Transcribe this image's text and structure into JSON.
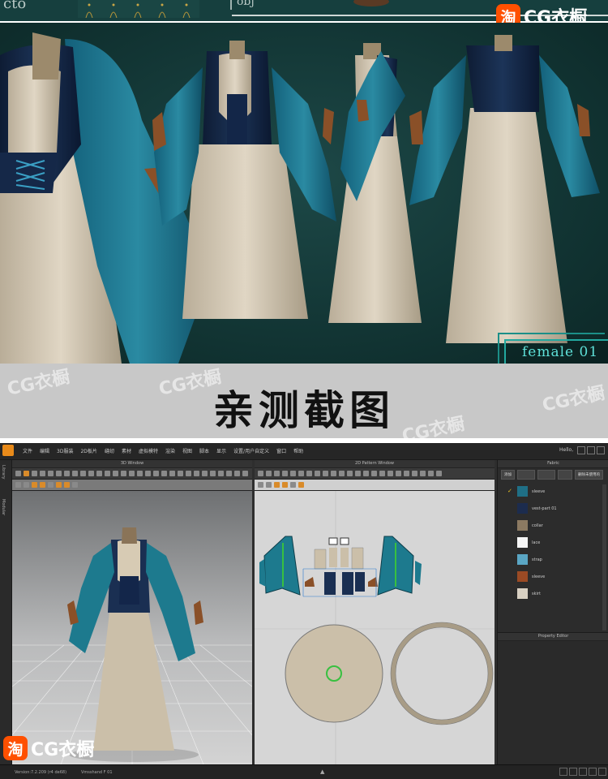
{
  "top_strip": {
    "left_text": "cto",
    "right_text": "obj"
  },
  "watermarks": {
    "brand_glyph": "淘",
    "brand_text": "CG衣橱",
    "ghost_text": "CG衣橱"
  },
  "hero": {
    "tag_text": "female 01"
  },
  "banner": {
    "title": "亲测截图"
  },
  "app": {
    "menu": [
      "文件",
      "编辑",
      "3D服装",
      "2D板片",
      "缝纫",
      "素材",
      "虚拟模特",
      "渲染",
      "视图",
      "脚本",
      "显示",
      "设置/用户自定义",
      "窗口",
      "帮助"
    ],
    "hello": "Hello,",
    "left_tabs": [
      "Library",
      "Modular"
    ],
    "window_3d_title": "3D Window",
    "window_2d_title": "2D Pattern Window",
    "fabric_title": "Fabric",
    "fabric_buttons": [
      "添加",
      "",
      "",
      "",
      "删除未使用的"
    ],
    "fabrics": [
      {
        "name": "sleeve",
        "color": "#1f6f86",
        "selected": true
      },
      {
        "name": "vest-part 01",
        "color": "#1c2c4e",
        "selected": false
      },
      {
        "name": "collar",
        "color": "#8c7a62",
        "selected": false
      },
      {
        "name": "lace",
        "color": "#f5f5f5",
        "selected": false
      },
      {
        "name": "strap",
        "color": "#5aa6c4",
        "selected": false
      },
      {
        "name": "sleeve",
        "color": "#9a4a24",
        "selected": false
      },
      {
        "name": "skirt",
        "color": "#d8d0c2",
        "selected": false
      }
    ],
    "property_editor_title": "Property Editor",
    "status": {
      "version_label": "Version:",
      "version_value": "7.2.209 (r4 de68)",
      "avatar": "Vmsshand F 01"
    }
  },
  "colors": {
    "teal": "#1d7a8e",
    "navy": "#142a46",
    "cream": "#d3c7b2",
    "leather": "#8a5028",
    "brand": "#ff5000"
  }
}
